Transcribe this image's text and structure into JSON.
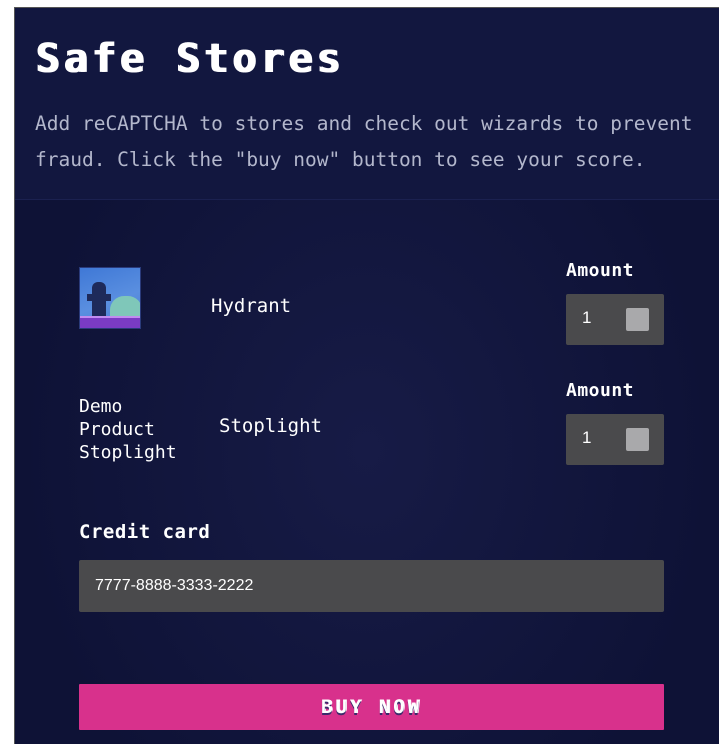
{
  "header": {
    "title": "Safe Stores",
    "subtitle": "Add reCAPTCHA to stores and check out wizards to prevent\nfraud. Click the \"buy now\" button to see your score."
  },
  "products": [
    {
      "name": "Hydrant",
      "image_alt": "",
      "amount_label": "Amount",
      "amount": "1"
    },
    {
      "name": "Stoplight",
      "image_alt": "Demo\nProduct\nStoplight",
      "amount_label": "Amount",
      "amount": "1"
    }
  ],
  "payment": {
    "label": "Credit card",
    "value": "7777-8888-3333-2222"
  },
  "actions": {
    "buy_label": "BUY NOW"
  },
  "colors": {
    "background": "#0e1236",
    "header_background": "#12173f",
    "input_background": "#4a4a4c",
    "accent": "#d8318c"
  },
  "icons": {
    "hydrant_image": "hydrant-product-image",
    "spinner": "number-spinner-icon"
  }
}
